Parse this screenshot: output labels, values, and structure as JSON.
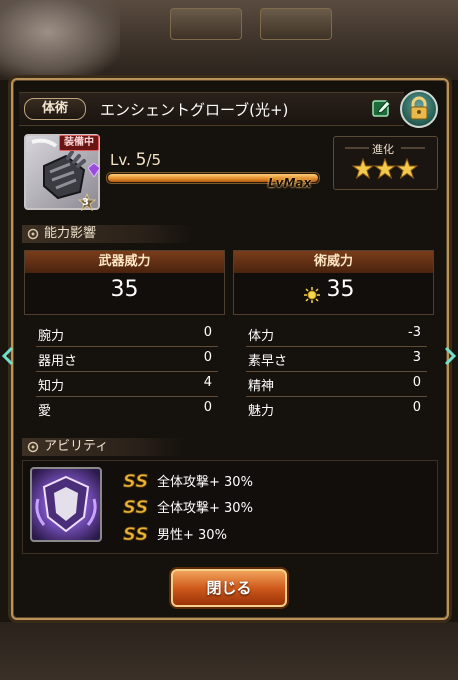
{
  "dialog": {
    "type_label": "体術",
    "item_name": "エンシェントグローブ(光+)",
    "equipped_badge": "装備中",
    "rank_number": "3",
    "level_prefix": "Lv.",
    "level_current": "5",
    "level_max": "/5",
    "level_progress": 1.0,
    "level_max_label": "LvMax",
    "evolution_label": "進化",
    "evolution_stars": 3,
    "evolution_stars_max": 3
  },
  "sections": {
    "stats_title": "能力影響",
    "ability_title": "アビリティ"
  },
  "power": {
    "weapon_label": "武器威力",
    "weapon_value": "35",
    "art_label": "術威力",
    "art_value": "35"
  },
  "attributes": {
    "left": [
      {
        "label": "腕力",
        "value": "0"
      },
      {
        "label": "器用さ",
        "value": "0"
      },
      {
        "label": "知力",
        "value": "4"
      },
      {
        "label": "愛",
        "value": "0"
      }
    ],
    "right": [
      {
        "label": "体力",
        "value": "-3"
      },
      {
        "label": "素早さ",
        "value": "3"
      },
      {
        "label": "精神",
        "value": "0"
      },
      {
        "label": "魅力",
        "value": "0"
      }
    ]
  },
  "abilities": [
    {
      "text": "全体攻撃+ 30%"
    },
    {
      "text": "全体攻撃+ 30%"
    },
    {
      "text": "男性+ 30%"
    }
  ],
  "close_label": "閉じる",
  "colors": {
    "frame": "#b9935a",
    "lock": "#2f6a61",
    "close_button": "#cf5a1c",
    "equipped": "#6a1414"
  }
}
